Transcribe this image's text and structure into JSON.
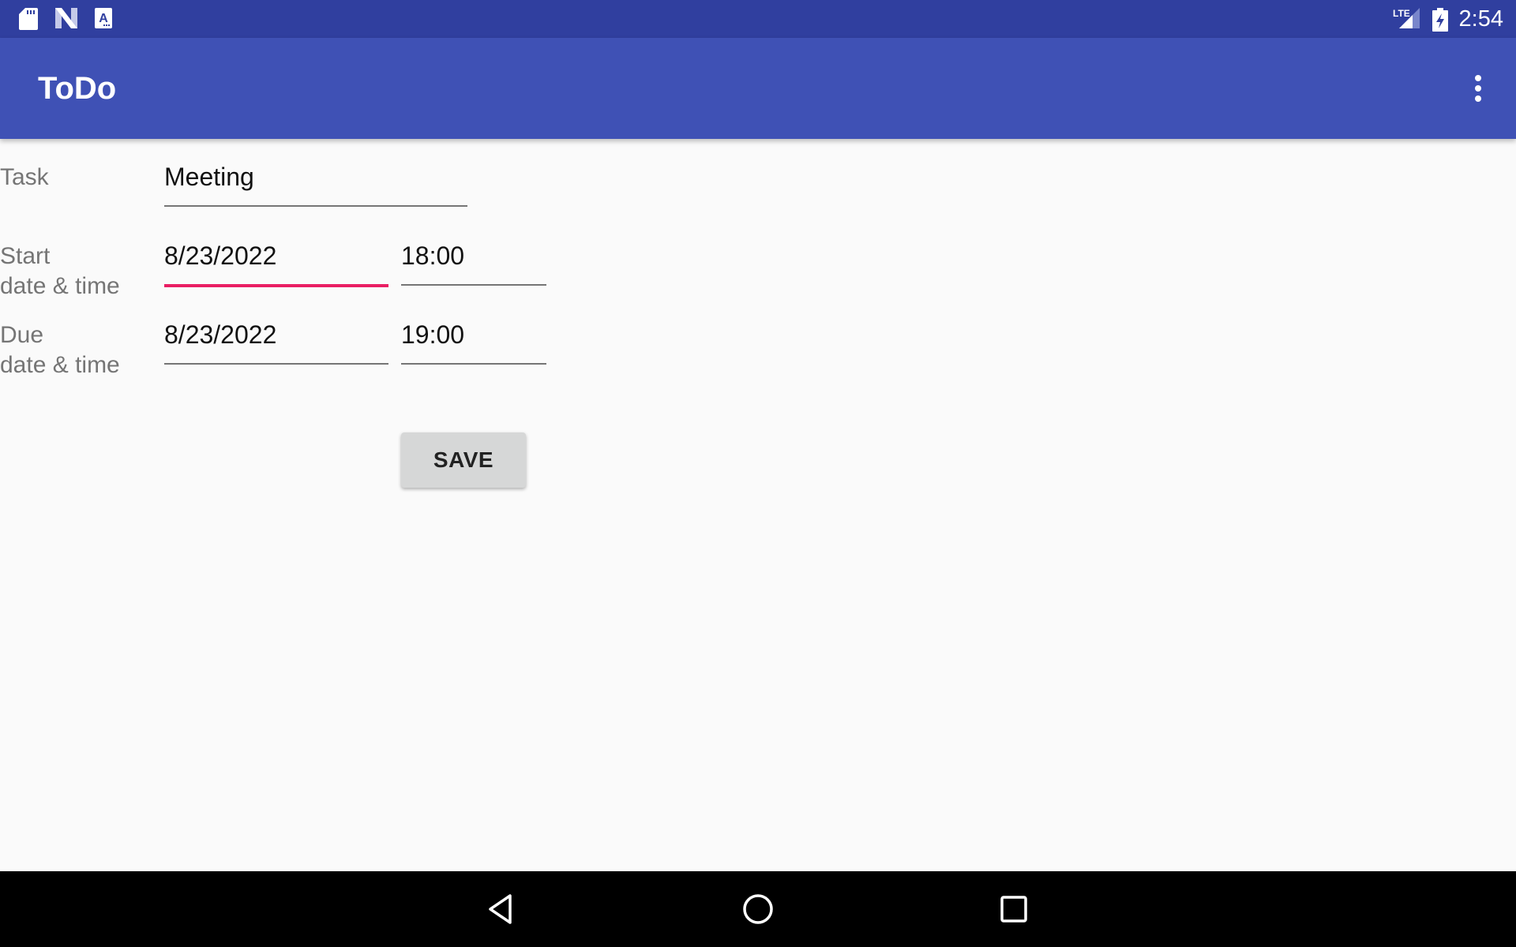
{
  "status_bar": {
    "left_icons": [
      "sd-card-icon",
      "n-app-icon",
      "a-keyboard-icon"
    ],
    "network_label": "LTE",
    "time": "2:54"
  },
  "app_bar": {
    "title": "ToDo",
    "menu_icon": "more-vert-icon"
  },
  "form": {
    "task": {
      "label": "Task",
      "value": "Meeting"
    },
    "start": {
      "label_line1": "Start",
      "label_line2": "date & time",
      "date": "8/23/2022",
      "time": "18:00"
    },
    "due": {
      "label_line1": "Due",
      "label_line2": "date & time",
      "date": "8/23/2022",
      "time": "19:00"
    },
    "save_label": "SAVE",
    "accent_color": "#e91e63"
  },
  "nav_bar": {
    "buttons": [
      "back-icon",
      "home-icon",
      "recents-icon"
    ]
  }
}
